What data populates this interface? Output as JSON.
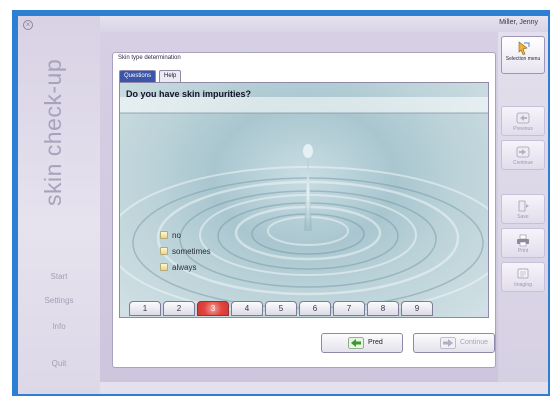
{
  "app": {
    "title": "skin check-up",
    "user": "Miller, Jenny",
    "close_symbol": "×"
  },
  "left_nav": {
    "items": [
      {
        "label": "Start"
      },
      {
        "label": "Settings"
      },
      {
        "label": "Info"
      },
      {
        "label": "Quit"
      }
    ]
  },
  "dialog": {
    "title": "Skin type determination",
    "tabs": [
      {
        "label": "Questions",
        "active": true
      },
      {
        "label": "Help",
        "active": false
      }
    ],
    "question": "Do you have skin impurities?",
    "options": [
      {
        "label": "no",
        "checked": false
      },
      {
        "label": "sometimes",
        "checked": false
      },
      {
        "label": "always",
        "checked": false
      }
    ],
    "steps": [
      "1",
      "2",
      "3",
      "4",
      "5",
      "6",
      "7",
      "8",
      "9"
    ],
    "current_step": 3,
    "buttons": {
      "previous": "Pred",
      "next": "Continue"
    }
  },
  "right_panel": {
    "buttons": [
      {
        "label": "Selection menu",
        "icon": "pointer-icon",
        "active": true
      },
      {
        "label": "Previous",
        "icon": "arrow-left-icon",
        "active": false
      },
      {
        "label": "Continue",
        "icon": "arrow-right-icon",
        "active": false
      },
      {
        "label": "Save",
        "icon": "save-icon",
        "active": false
      },
      {
        "label": "Print",
        "icon": "print-icon",
        "active": false
      },
      {
        "label": "Imaging",
        "icon": "imaging-icon",
        "active": false
      }
    ]
  },
  "colors": {
    "frame": "#2d7fd4",
    "active_tab": "#3b55a8",
    "active_step": "#e2433d",
    "accent_green": "#3a9a2a"
  }
}
